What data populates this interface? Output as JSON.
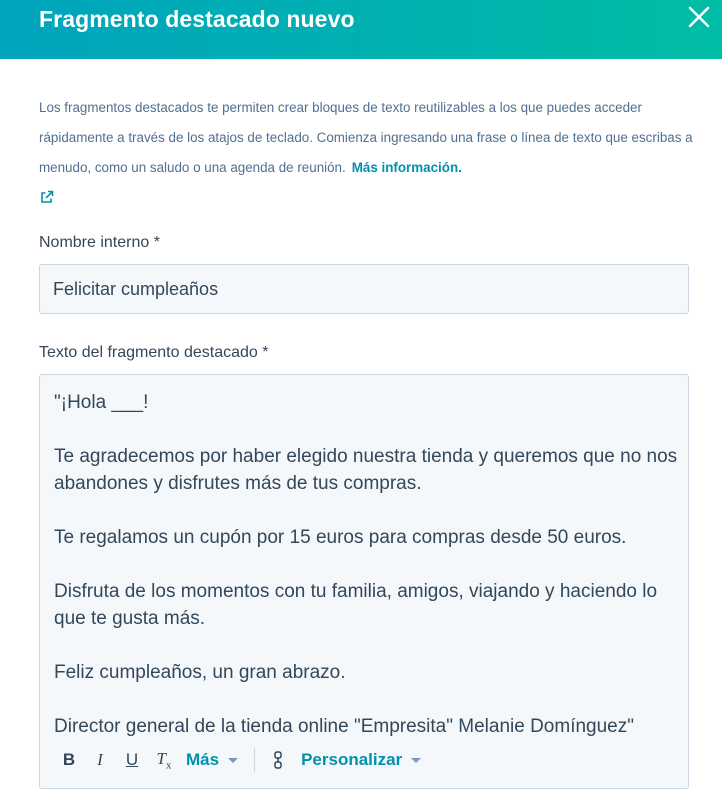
{
  "header": {
    "title": "Fragmento destacado nuevo",
    "close_icon": "close-icon",
    "gradient_from": "#00a4bd",
    "gradient_to": "#00bda5"
  },
  "intro": {
    "text": "Los fragmentos destacados te permiten crear bloques de texto reutilizables a los que puedes acceder rápidamente a través de los atajos de teclado. Comienza ingresando una frase o línea de texto que escribas a menudo, como un saludo o una agenda de reunión.",
    "link_label": "Más información.",
    "link_icon": "external-link-icon"
  },
  "form": {
    "name_label": "Nombre interno *",
    "name_value": "Felicitar cumpleaños",
    "text_label": "Texto del fragmento destacado *"
  },
  "editor": {
    "paragraphs": [
      "\"¡Hola ___!",
      "Te agradecemos por haber elegido nuestra tienda y queremos que no nos abandones y disfrutes más de tus compras.",
      "Te regalamos un cupón por 15 euros para compras desde 50 euros.",
      "Disfruta de los momentos con tu familia, amigos, viajando y haciendo lo que te gusta más.",
      "Feliz cumpleaños, un gran abrazo.",
      "Director general de la tienda online \"Empresita\" Melanie Domínguez\""
    ],
    "toolbar": {
      "bold": "B",
      "italic": "I",
      "underline": "U",
      "clear_format": "T",
      "clear_format_sub": "x",
      "more_label": "Más",
      "personalize_icon": "snippet-icon",
      "personalize_label": "Personalizar"
    }
  },
  "colors": {
    "accent": "#0091ae",
    "text": "#33475b",
    "muted_text": "#516f90",
    "field_bg": "#f5f8fa",
    "field_border": "#cbd6e2"
  }
}
